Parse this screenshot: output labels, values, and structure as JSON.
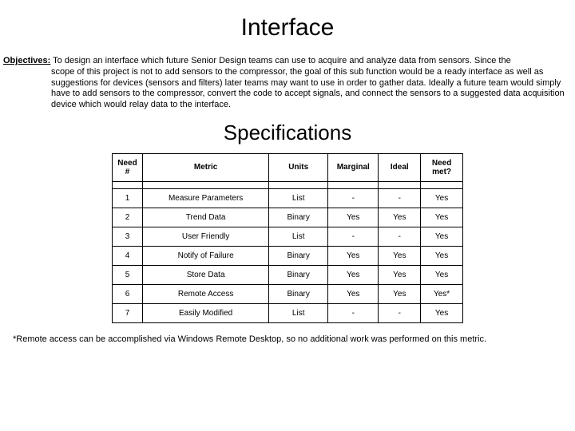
{
  "title": "Interface",
  "objectives": {
    "label": "Objectives:",
    "first_line": " To design an interface which future Senior Design teams can use to acquire and analyze data from sensors. Since the",
    "rest": "scope of this project is not to add sensors to the compressor, the goal of this sub function would be a ready interface as well as suggestions for devices (sensors and filters) later teams may want to use in order to gather data. Ideally a future team would simply have to add sensors to the compressor, convert the code to accept signals, and connect the sensors to a suggested data acquisition device which would relay data to the interface."
  },
  "subtitle": "Specifications",
  "headers": {
    "need_no": "Need #",
    "metric": "Metric",
    "units": "Units",
    "marginal": "Marginal",
    "ideal": "Ideal",
    "need_met": "Need met?"
  },
  "rows": [
    {
      "need_no": "1",
      "metric": "Measure Parameters",
      "units": "List",
      "marginal": "-",
      "ideal": "-",
      "need_met": "Yes"
    },
    {
      "need_no": "2",
      "metric": "Trend Data",
      "units": "Binary",
      "marginal": "Yes",
      "ideal": "Yes",
      "need_met": "Yes"
    },
    {
      "need_no": "3",
      "metric": "User Friendly",
      "units": "List",
      "marginal": "-",
      "ideal": "-",
      "need_met": "Yes"
    },
    {
      "need_no": "4",
      "metric": "Notify of Failure",
      "units": "Binary",
      "marginal": "Yes",
      "ideal": "Yes",
      "need_met": "Yes"
    },
    {
      "need_no": "5",
      "metric": "Store Data",
      "units": "Binary",
      "marginal": "Yes",
      "ideal": "Yes",
      "need_met": "Yes"
    },
    {
      "need_no": "6",
      "metric": "Remote Access",
      "units": "Binary",
      "marginal": "Yes",
      "ideal": "Yes",
      "need_met": "Yes*"
    },
    {
      "need_no": "7",
      "metric": "Easily Modified",
      "units": "List",
      "marginal": "-",
      "ideal": "-",
      "need_met": "Yes"
    }
  ],
  "footnote": "*Remote access can be accomplished via Windows Remote Desktop, so no additional work was performed on this metric.",
  "chart_data": {
    "type": "table",
    "title": "Specifications",
    "columns": [
      "Need #",
      "Metric",
      "Units",
      "Marginal",
      "Ideal",
      "Need met?"
    ],
    "rows": [
      [
        "1",
        "Measure Parameters",
        "List",
        "-",
        "-",
        "Yes"
      ],
      [
        "2",
        "Trend Data",
        "Binary",
        "Yes",
        "Yes",
        "Yes"
      ],
      [
        "3",
        "User Friendly",
        "List",
        "-",
        "-",
        "Yes"
      ],
      [
        "4",
        "Notify of Failure",
        "Binary",
        "Yes",
        "Yes",
        "Yes"
      ],
      [
        "5",
        "Store Data",
        "Binary",
        "Yes",
        "Yes",
        "Yes"
      ],
      [
        "6",
        "Remote Access",
        "Binary",
        "Yes",
        "Yes",
        "Yes*"
      ],
      [
        "7",
        "Easily Modified",
        "List",
        "-",
        "-",
        "Yes"
      ]
    ]
  }
}
